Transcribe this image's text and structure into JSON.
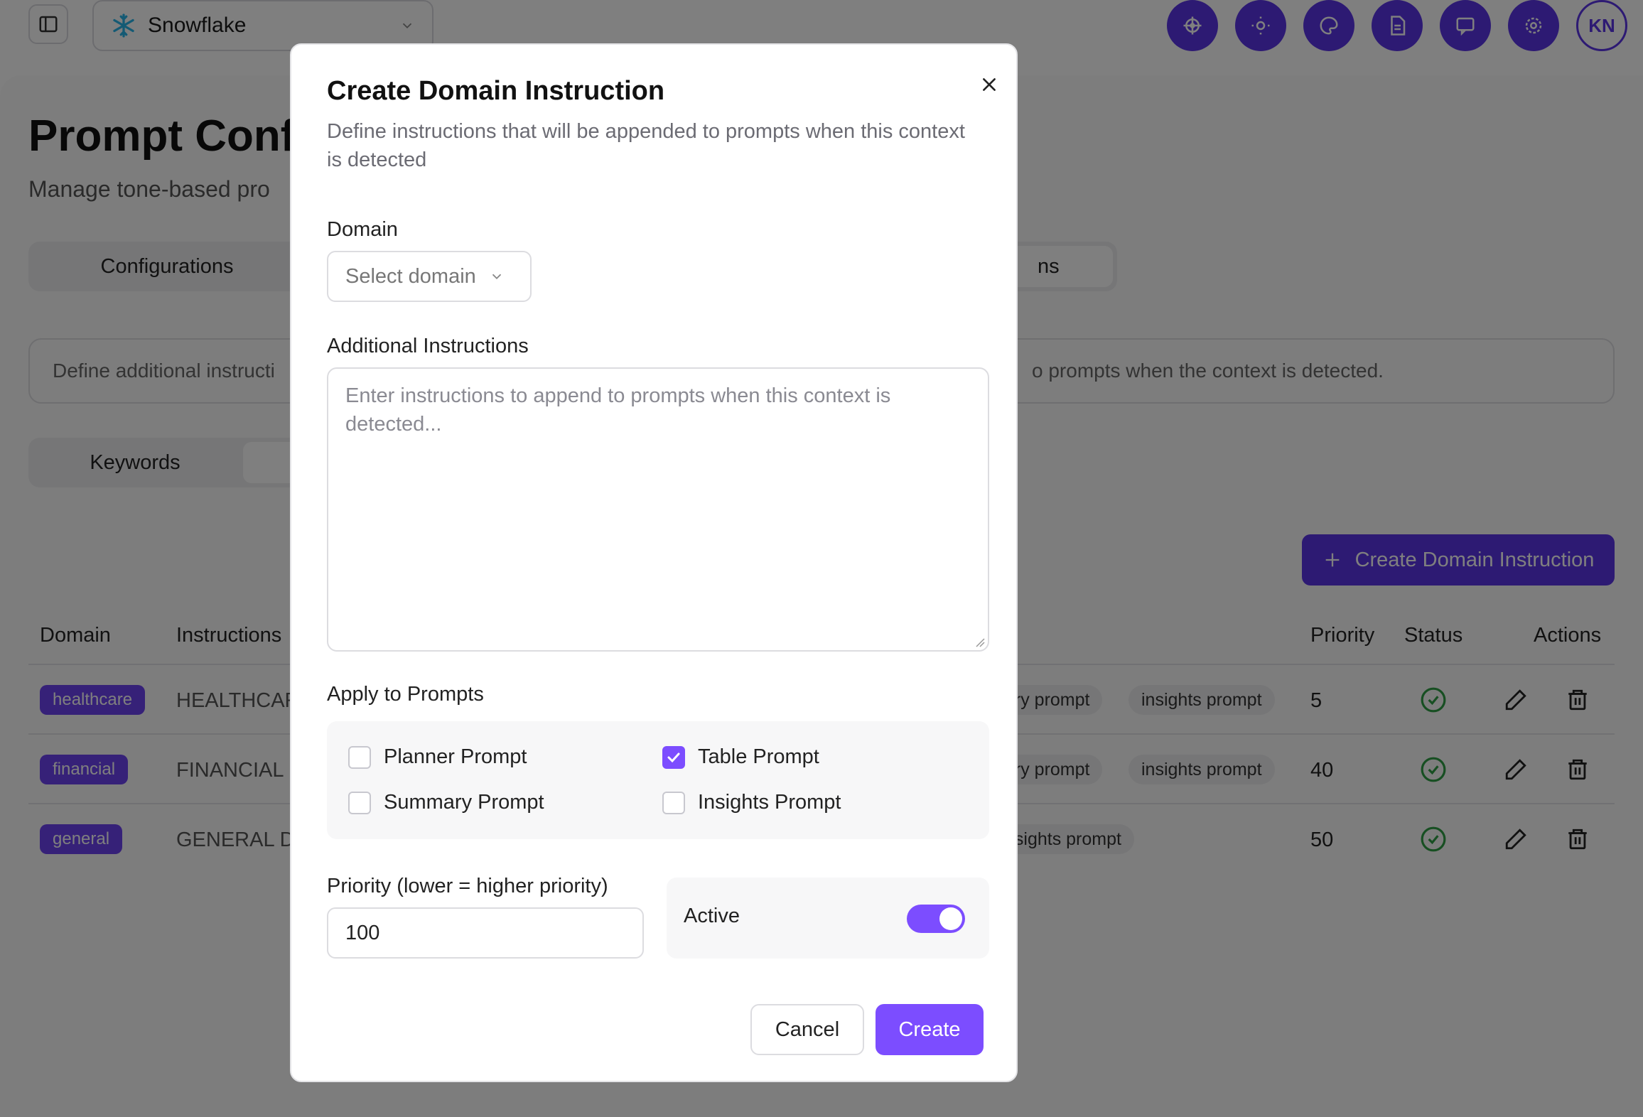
{
  "header": {
    "workspace_name": "Snowflake",
    "avatar_initials": "KN",
    "toolbar_icons": [
      "helm-icon",
      "sun-icon",
      "palette-icon",
      "document-icon",
      "chat-icon",
      "gear-icon"
    ]
  },
  "page": {
    "title": "Prompt Confi",
    "subtitle": "Manage tone-based pro",
    "tabs": [
      {
        "label": "Configurations"
      },
      {
        "label": "ns"
      }
    ],
    "info_text": "Define additional instructi",
    "info_text_tail": "o prompts when the context is detected.",
    "subtabs": [
      {
        "label": "Keywords"
      }
    ],
    "create_button": "Create Domain Instruction"
  },
  "table": {
    "headers": {
      "domain": "Domain",
      "instructions": "Instructions",
      "priority": "Priority",
      "status": "Status",
      "actions": "Actions"
    },
    "rows": [
      {
        "domain": "healthcare",
        "instructions": "HEALTHCAR",
        "pill1": "ary prompt",
        "pill2": "insights prompt",
        "priority": "5"
      },
      {
        "domain": "financial",
        "instructions": "FINANCIAL I",
        "pill1": "ary prompt",
        "pill2": "insights prompt",
        "priority": "40"
      },
      {
        "domain": "general",
        "instructions": "GENERAL D",
        "pill1": "nsights prompt",
        "priority": "50"
      }
    ]
  },
  "modal": {
    "title": "Create Domain Instruction",
    "description": "Define instructions that will be appended to prompts when this context is detected",
    "domain_label": "Domain",
    "domain_placeholder": "Select domain",
    "instructions_label": "Additional Instructions",
    "instructions_placeholder": "Enter instructions to append to prompts when this context is detected...",
    "apply_label": "Apply to Prompts",
    "prompts": [
      {
        "label": "Planner Prompt",
        "checked": false
      },
      {
        "label": "Table Prompt",
        "checked": true
      },
      {
        "label": "Summary Prompt",
        "checked": false
      },
      {
        "label": "Insights Prompt",
        "checked": false
      }
    ],
    "priority_label": "Priority (lower = higher priority)",
    "priority_value": "100",
    "active_label": "Active",
    "active_on": true,
    "cancel_label": "Cancel",
    "create_label": "Create"
  },
  "colors": {
    "accent": "#7c4dff",
    "brand_dark": "#5b34e6",
    "success": "#2e9e44"
  }
}
